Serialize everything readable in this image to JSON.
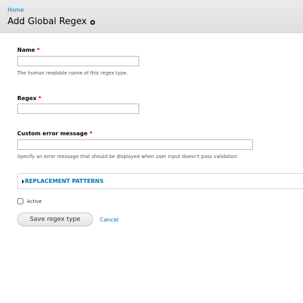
{
  "breadcrumb": {
    "home": "Home"
  },
  "page": {
    "title": "Add Global Regex"
  },
  "icons": {
    "shortcut": "add-shortcut-circle-icon",
    "details": "triangle-right-icon"
  },
  "form": {
    "required_marker": "*",
    "name": {
      "label": "Name",
      "value": "",
      "description": "The human readable name of this regex type."
    },
    "regex": {
      "label": "Regex",
      "value": ""
    },
    "custom_error": {
      "label": "Custom error message",
      "value": "",
      "description": "Specify an error message that should be displayed when user input doesn't pass validation"
    },
    "replacement_patterns": {
      "summary": "REPLACEMENT PATTERNS"
    },
    "active": {
      "label": "Active",
      "checked": false
    },
    "actions": {
      "save_label": "Save regex type",
      "cancel_label": "Cancel"
    }
  },
  "colors": {
    "link": "#0074bd",
    "required": "#e00000",
    "header_bg": "#e4e4e4"
  }
}
